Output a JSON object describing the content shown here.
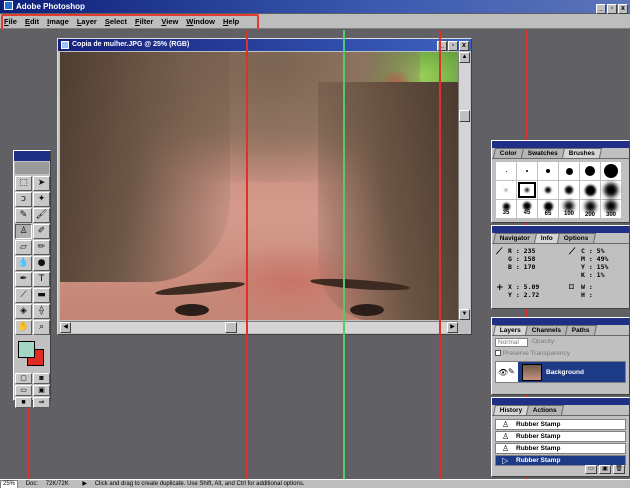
{
  "app": {
    "title": "Adobe Photoshop"
  },
  "window_buttons": [
    "_",
    "▫",
    "x"
  ],
  "menu": [
    "File",
    "Edit",
    "Image",
    "Layer",
    "Select",
    "Filter",
    "View",
    "Window",
    "Help"
  ],
  "document": {
    "title": "Copia de mulher.JPG @ 25% (RGB)"
  },
  "brushes_palette": {
    "tabs": [
      "Color",
      "Swatches",
      "Brushes"
    ],
    "sizes": [
      "35",
      "45",
      "65",
      "100",
      "200",
      "300"
    ]
  },
  "info_palette": {
    "tabs": [
      "Navigator",
      "Info",
      "Options"
    ],
    "rgb": {
      "labels": [
        "R :",
        "G :",
        "B :"
      ],
      "values": [
        "235",
        "158",
        "170"
      ]
    },
    "cmyk": {
      "labels": [
        "C :",
        "M :",
        "Y :",
        "K :"
      ],
      "values": [
        "5%",
        "49%",
        "15%",
        "1%"
      ]
    },
    "xy": {
      "labels": [
        "X :",
        "Y :"
      ],
      "values": [
        "5.09",
        "2.72"
      ]
    },
    "wh": {
      "labels": [
        "W :",
        "H :"
      ]
    }
  },
  "layers_palette": {
    "tabs": [
      "Layers",
      "Channels",
      "Paths"
    ],
    "blend_mode": "Normal",
    "opacity_label": "Opacity:",
    "preserve_transparency": "Preserve Transparency",
    "layer_name": "Background"
  },
  "history_palette": {
    "tabs": [
      "History",
      "Actions"
    ],
    "items": [
      "Rubber Stamp",
      "Rubber Stamp",
      "Rubber Stamp",
      "Rubber Stamp"
    ]
  },
  "status": {
    "zoom": "25%",
    "doc_label": "Doc:",
    "doc_size": "72K/72K",
    "hint": "Click and drag to create duplicate. Use Shift, Alt, and Ctrl for additional options."
  },
  "colors": {
    "foreground": "#a3d6c5",
    "background": "#e02a24",
    "highlight": "#e23b32"
  }
}
